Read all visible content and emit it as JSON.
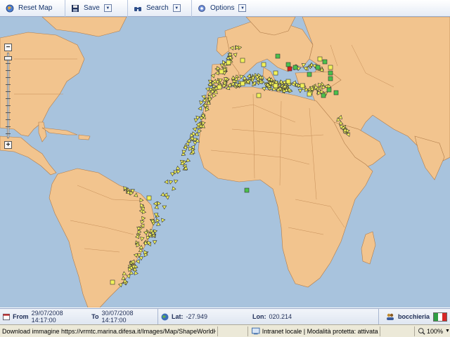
{
  "toolbar": {
    "reset_label": "Reset Map",
    "save_label": "Save",
    "search_label": "Search",
    "options_label": "Options"
  },
  "status": {
    "from_label": "From",
    "from_value": "29/07/2008 14:17:00",
    "to_label": "To",
    "to_value": "30/07/2008 14:17:00",
    "lat_label": "Lat:",
    "lat_value": "-27.949",
    "lon_label": "Lon:",
    "lon_value": "020.214",
    "user": "bocchieria",
    "flag_colors": [
      "#2f9e44",
      "#ffffff",
      "#d62828"
    ]
  },
  "browser_status": {
    "download_text": "Download immagine https://vrmtc.marina.difesa.it/Images/Map/ShapeWorldHD/...",
    "zone_text": "Intranet locale | Modalità protetta: attivata",
    "zoom_text": "100%"
  },
  "colors": {
    "sea": "#a8c3dd",
    "land": "#f2c48e",
    "border": "#b07c4a",
    "vessel_yellow": "#f2f25a",
    "vessel_green": "#4bc04b",
    "vessel_red": "#d42020"
  }
}
